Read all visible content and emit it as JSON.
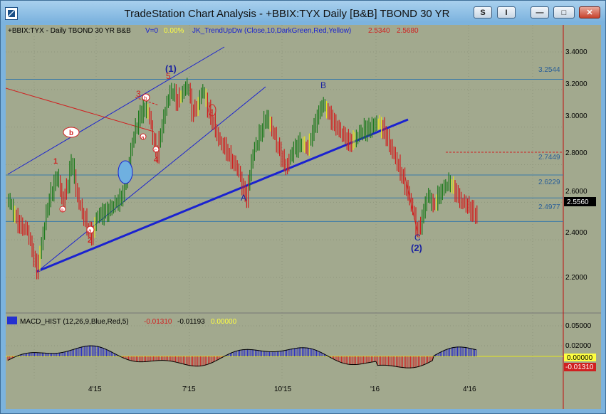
{
  "window": {
    "title": "TradeStation Chart Analysis - +BBIX:TYX Daily [B&B] TBOND 30 YR",
    "buttons": {
      "symbol": "S",
      "indicator": "I",
      "minimize": "—",
      "maximize": "□",
      "close": "✕"
    }
  },
  "header": {
    "symbol_line": "+BBIX:TYX - Daily  TBOND 30 YR  B&B",
    "volume": "V=0",
    "volume_pct": "0.00%",
    "study": "JK_TrendUpDw (Close,10,DarkGreen,Red,Yellow)",
    "study_val1": "2.5340",
    "study_val2": "2.5680"
  },
  "price_axis": {
    "ticks": [
      "3.4000",
      "3.2000",
      "3.0000",
      "2.8000",
      "2.6000",
      "2.4000",
      "2.2000"
    ],
    "last_price": "2.5560"
  },
  "levels": [
    {
      "label": "3.2544",
      "value": 3.2544
    },
    {
      "label": "2.7449",
      "value": 2.7449
    },
    {
      "label": "2.6229",
      "value": 2.6229
    },
    {
      "label": "2.4977",
      "value": 2.4977
    }
  ],
  "wave_labels": {
    "w1": "(1)",
    "w5": "5",
    "w3": "3",
    "w4": "4",
    "w2": "2",
    "w1a": "1",
    "wa": "A",
    "wb": "B",
    "wc": "C",
    "w2b": "(2)",
    "ci_a": "a",
    "ci_b": "b",
    "ci_c": "c"
  },
  "macd": {
    "title": "MACD_HIST (12,26,9,Blue,Red,5)",
    "v1": "-0.01310",
    "v2": "-0.01193",
    "v3": "0.00000",
    "ticks": [
      "0.05000",
      "0.02000"
    ],
    "zero_label": "0.00000",
    "last_label": "-0.01310"
  },
  "date_axis": [
    "4'15",
    "7'15",
    "10'15",
    "'16",
    "4'16"
  ],
  "colors": {
    "chart_bg": "#a2a98e",
    "up_bar": "#1e7a1e",
    "down_bar": "#d02020",
    "neutral_bar": "#e6e61e",
    "trendline": "#1a22d0",
    "level_line": "#3a7aa8",
    "macd_pos": "#1e22c8",
    "macd_neg": "#d02020"
  }
}
